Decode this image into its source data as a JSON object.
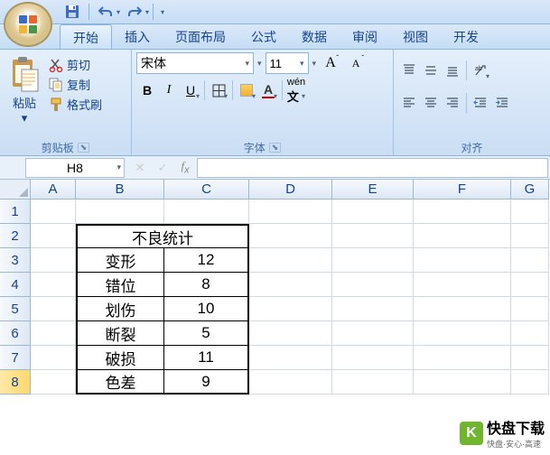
{
  "qat": {
    "save": "save",
    "undo": "undo",
    "redo": "redo"
  },
  "tabs": [
    "开始",
    "插入",
    "页面布局",
    "公式",
    "数据",
    "审阅",
    "视图",
    "开发"
  ],
  "active_tab": 0,
  "clipboard": {
    "paste": "粘贴",
    "cut": "剪切",
    "copy": "复制",
    "format": "格式刷",
    "group_label": "剪贴板"
  },
  "font": {
    "name": "宋体",
    "size": "11",
    "group_label": "字体"
  },
  "align": {
    "group_label": "对齐"
  },
  "namebox": "H8",
  "formula": "",
  "columns": [
    {
      "label": "A",
      "width": 50
    },
    {
      "label": "B",
      "width": 98
    },
    {
      "label": "C",
      "width": 94
    },
    {
      "label": "D",
      "width": 92
    },
    {
      "label": "E",
      "width": 90
    },
    {
      "label": "F",
      "width": 108
    },
    {
      "label": "G",
      "width": 42
    }
  ],
  "rows": [
    {
      "n": "1",
      "cells": [
        "",
        "",
        "",
        "",
        "",
        "",
        ""
      ]
    },
    {
      "n": "2",
      "cells": [
        "",
        "",
        "",
        "",
        "",
        "",
        ""
      ],
      "merge_bc": "不良统计"
    },
    {
      "n": "3",
      "cells": [
        "",
        "变形",
        "12",
        "",
        "",
        "",
        ""
      ]
    },
    {
      "n": "4",
      "cells": [
        "",
        "错位",
        "8",
        "",
        "",
        "",
        ""
      ]
    },
    {
      "n": "5",
      "cells": [
        "",
        "划伤",
        "10",
        "",
        "",
        "",
        ""
      ]
    },
    {
      "n": "6",
      "cells": [
        "",
        "断裂",
        "5",
        "",
        "",
        "",
        ""
      ]
    },
    {
      "n": "7",
      "cells": [
        "",
        "破损",
        "11",
        "",
        "",
        "",
        ""
      ]
    },
    {
      "n": "8",
      "cells": [
        "",
        "色差",
        "9",
        "",
        "",
        "",
        ""
      ]
    }
  ],
  "watermark": {
    "brand": "快盘下载",
    "tag": "快盘·安心·高速"
  },
  "chart_data": {
    "type": "table",
    "title": "不良统计",
    "categories": [
      "变形",
      "错位",
      "划伤",
      "断裂",
      "破损",
      "色差"
    ],
    "values": [
      12,
      8,
      10,
      5,
      11,
      9
    ]
  }
}
